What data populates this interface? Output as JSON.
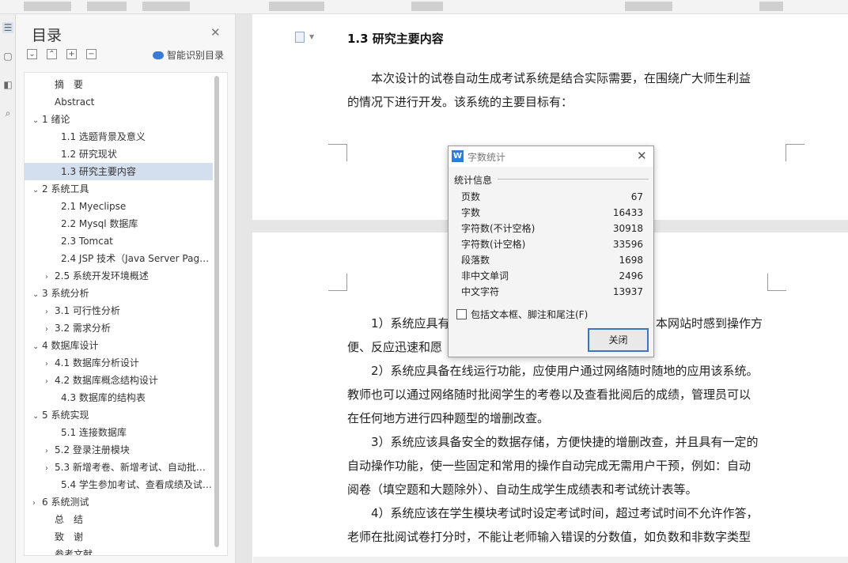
{
  "outline": {
    "title": "目录",
    "smart_label": "智能识别目录",
    "items": [
      {
        "label": "摘　要",
        "level": 1,
        "caret": ""
      },
      {
        "label": "Abstract",
        "level": 1,
        "caret": ""
      },
      {
        "label": "1 绪论",
        "level": 1,
        "caret": "v"
      },
      {
        "label": "1.1 选题背景及意义",
        "level": 2,
        "caret": ""
      },
      {
        "label": "1.2 研究现状",
        "level": 2,
        "caret": ""
      },
      {
        "label": "1.3 研究主要内容",
        "level": 2,
        "caret": "",
        "selected": true
      },
      {
        "label": "2 系统工具",
        "level": 1,
        "caret": "v"
      },
      {
        "label": "2.1 Myeclipse",
        "level": 2,
        "caret": ""
      },
      {
        "label": "2.2 Mysql 数据库",
        "level": 2,
        "caret": ""
      },
      {
        "label": "2.3 Tomcat",
        "level": 2,
        "caret": ""
      },
      {
        "label": "2.4 JSP 技术（Java Server Page…",
        "level": 2,
        "caret": ""
      },
      {
        "label": "2.5 系统开发环境概述",
        "level": 2,
        "caret": ">"
      },
      {
        "label": "3 系统分析",
        "level": 1,
        "caret": "v"
      },
      {
        "label": "3.1 可行性分析",
        "level": 2,
        "caret": ">"
      },
      {
        "label": "3.2  需求分析",
        "level": 2,
        "caret": ">"
      },
      {
        "label": "4 数据库设计",
        "level": 1,
        "caret": "v"
      },
      {
        "label": "4.1 数据库分析设计",
        "level": 2,
        "caret": ">"
      },
      {
        "label": "4.2 数据库概念结构设计",
        "level": 2,
        "caret": ">"
      },
      {
        "label": "4.3 数据库的结构表",
        "level": 2,
        "caret": ""
      },
      {
        "label": "5 系统实现",
        "level": 1,
        "caret": "v"
      },
      {
        "label": "5.1 连接数据库",
        "level": 2,
        "caret": ""
      },
      {
        "label": "5.2  登录注册模块",
        "level": 2,
        "caret": ">"
      },
      {
        "label": "5.3 新增考卷、新增考试、自动批…",
        "level": 2,
        "caret": ">"
      },
      {
        "label": "5.4 学生参加考试、查看成绩及试…",
        "level": 2,
        "caret": ""
      },
      {
        "label": "6 系统测试",
        "level": 1,
        "caret": ">"
      },
      {
        "label": "总　结",
        "level": 1,
        "caret": ""
      },
      {
        "label": "致　谢",
        "level": 1,
        "caret": ""
      },
      {
        "label": "参考文献",
        "level": 1,
        "caret": ""
      }
    ]
  },
  "document": {
    "heading": "1.3 研究主要内容",
    "page1_lines": [
      "　　本次设计的试卷自动生成考试系统是结合实际需要，在围绕广大师生利益",
      "的情况下进行开发。该系统的主要目标有："
    ],
    "page2_lines": [
      "　　1）系统应具有",
      "便、反应迅速和愿",
      "　　2）系统应具备在线运行功能，应使用户通过网络随时随地的应用该系统。",
      "教师也可以通过网络随时批阅学生的考卷以及查看批阅后的成绩，管理员可以",
      "在任何地方进行四种题型的增删改查。",
      "　　3）系统应该具备安全的数据存储，方便快捷的增删改查，并且具有一定的",
      "自动操作功能，使一些固定和常用的操作自动完成无需用户干预，例如：自动",
      "阅卷（填空题和大题除外）、自动生成学生成绩表和考试统计表等。",
      "　　4）系统应该在学生模块考试时设定考试时间，超过考试时间不允许作答，",
      "老师在批阅试卷打分时，不能让老师输入错误的分数值，如负数和非数字类型"
    ],
    "page2_tail": "本网站时感到操作方"
  },
  "dialog": {
    "title": "字数统计",
    "group_label": "统计信息",
    "stats": [
      {
        "label": "页数",
        "value": "67"
      },
      {
        "label": "字数",
        "value": "16433"
      },
      {
        "label": "字符数(不计空格)",
        "value": "30918"
      },
      {
        "label": "字符数(计空格)",
        "value": "33596"
      },
      {
        "label": "段落数",
        "value": "1698"
      },
      {
        "label": "非中文单词",
        "value": "2496"
      },
      {
        "label": "中文字符",
        "value": "13937"
      }
    ],
    "checkbox_label": "包括文本框、脚注和尾注(F)",
    "close_button": "关闭"
  }
}
